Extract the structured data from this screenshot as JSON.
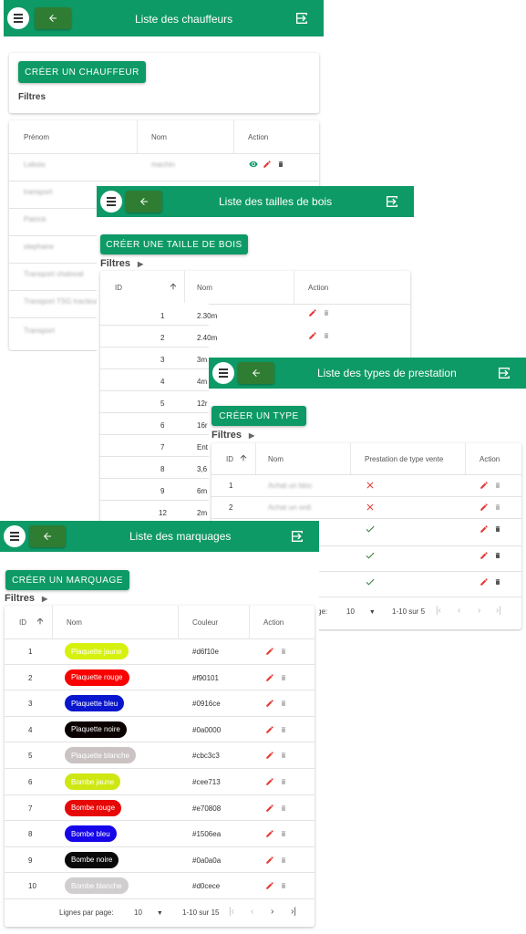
{
  "chauffeurs": {
    "title": "Liste des chauffeurs",
    "create_label": "CRÉER UN CHAUFFEUR",
    "filters_label": "Filtres",
    "columns": [
      "Prénom",
      "Nom",
      "Action"
    ],
    "rows": [
      {
        "prenom": "Lebois",
        "nom": "machin"
      },
      {
        "prenom": "transport",
        "nom": ""
      },
      {
        "prenom": "Patrick",
        "nom": ""
      },
      {
        "prenom": "stephane",
        "nom": ""
      },
      {
        "prenom": "Transport chaloval",
        "nom": ""
      },
      {
        "prenom": "Transport TSG tracteur",
        "nom": ""
      },
      {
        "prenom": "Transport",
        "nom": ""
      }
    ]
  },
  "tailles": {
    "title": "Liste des tailles de bois",
    "create_label": "CRÉER UNE TAILLE DE BOIS",
    "filters_label": "Filtres",
    "columns": [
      "ID",
      "Nom",
      "Action"
    ],
    "rows": [
      {
        "id": "1",
        "nom": "2.30m"
      },
      {
        "id": "2",
        "nom": "2.40m"
      },
      {
        "id": "3",
        "nom": "3m"
      },
      {
        "id": "4",
        "nom": "4m"
      },
      {
        "id": "5",
        "nom": "12r"
      },
      {
        "id": "6",
        "nom": "16r"
      },
      {
        "id": "7",
        "nom": "Ent"
      },
      {
        "id": "8",
        "nom": "3,6"
      },
      {
        "id": "9",
        "nom": "6m"
      },
      {
        "id": "12",
        "nom": "2m"
      }
    ]
  },
  "types": {
    "title": "Liste des types de prestation",
    "create_label": "CRÉER UN TYPE",
    "filters_label": "Filtres",
    "columns": [
      "ID",
      "Nom",
      "Prestation de type vente",
      "Action"
    ],
    "rows": [
      {
        "id": "1",
        "nom": "Achat un bloc",
        "vente": "no"
      },
      {
        "id": "2",
        "nom": "Achat un ordi",
        "vente": "no"
      },
      {
        "id": "",
        "nom": "",
        "vente": "yes"
      },
      {
        "id": "",
        "nom": "",
        "vente": "yes"
      },
      {
        "id": "",
        "nom": "",
        "vente": "yes"
      }
    ],
    "pagination": {
      "rows_label": "ge:",
      "rows_value": "10",
      "range": "1-10 sur 5"
    }
  },
  "marquages": {
    "title": "Liste des marquages",
    "create_label": "CRÉER UN MARQUAGE",
    "filters_label": "Filtres",
    "columns": [
      "ID",
      "Nom",
      "Couleur",
      "Action"
    ],
    "rows": [
      {
        "id": "1",
        "nom": "Plaquette jaune",
        "couleur": "#d6f10e",
        "text_color": "#ffffff"
      },
      {
        "id": "2",
        "nom": "Plaquette rouge",
        "couleur": "#f90101",
        "text_color": "#ffffff"
      },
      {
        "id": "3",
        "nom": "Plaquette bleu",
        "couleur": "#0916ce",
        "text_color": "#ffffff"
      },
      {
        "id": "4",
        "nom": "Plaquette noire",
        "couleur": "#0a0000",
        "text_color": "#ffffff"
      },
      {
        "id": "5",
        "nom": "Plaquette blanche",
        "couleur": "#cbc3c3",
        "text_color": "#ffffff"
      },
      {
        "id": "6",
        "nom": "Bombe jaune",
        "couleur": "#cee713",
        "text_color": "#ffffff"
      },
      {
        "id": "7",
        "nom": "Bombe rouge",
        "couleur": "#e70808",
        "text_color": "#ffffff"
      },
      {
        "id": "8",
        "nom": "Bombe bleu",
        "couleur": "#1506ea",
        "text_color": "#ffffff"
      },
      {
        "id": "9",
        "nom": "Bombe noire",
        "couleur": "#0a0a0a",
        "text_color": "#ffffff"
      },
      {
        "id": "10",
        "nom": "Bombe blanche",
        "couleur": "#d0cece",
        "text_color": "#ffffff"
      }
    ],
    "pagination": {
      "rows_label": "Lignes par page:",
      "rows_value": "10",
      "range": "1-10 sur 15"
    }
  },
  "colors": {
    "primary": "#0e9a67",
    "back": "#2f7d32",
    "edit": "#e53935",
    "view": "#0e9a67",
    "check": "#2e7d32",
    "cross": "#e53935"
  }
}
